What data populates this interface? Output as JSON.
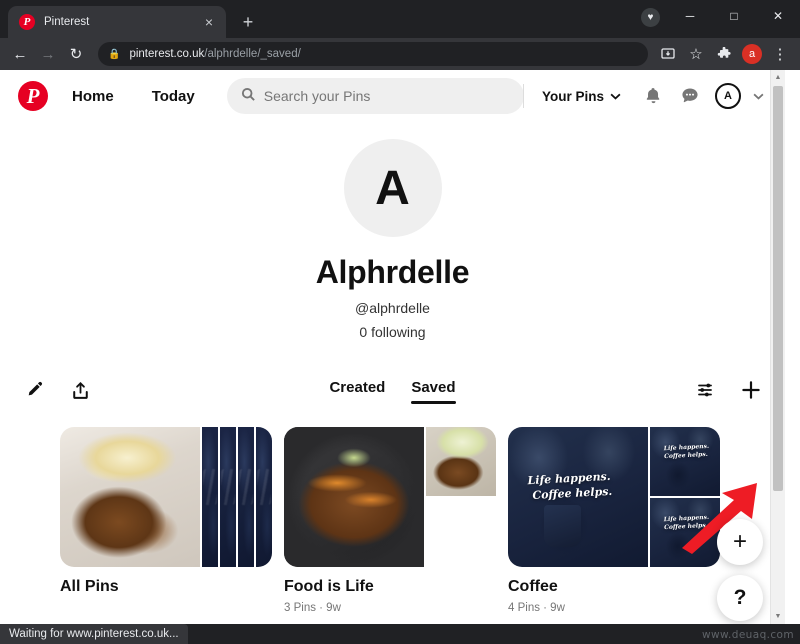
{
  "browser": {
    "tab": {
      "title": "Pinterest",
      "favicon": "pinterest-icon",
      "close": "×"
    },
    "new_tab_label": "+",
    "window_controls": {
      "minimize": "─",
      "maximize": "□",
      "close": "✕"
    },
    "nav": {
      "back": "←",
      "forward": "→",
      "reload": "↻"
    },
    "omnibox": {
      "lock_icon": "lock-icon",
      "domain": "pinterest.co.uk",
      "path": "/alphrdelle/_saved/",
      "install_icon": "install-app-icon",
      "bookmark_icon": "☆",
      "extensions_icon": "puzzle-icon",
      "profile_initial": "a",
      "menu_icon": "⋮"
    },
    "status_text": "Waiting for www.pinterest.co.uk...",
    "watermark": "www.deuaq.com"
  },
  "pinterest": {
    "logo": "pinterest-logo",
    "nav_links": [
      {
        "label": "Home",
        "name": "nav-home"
      },
      {
        "label": "Today",
        "name": "nav-today"
      }
    ],
    "search": {
      "placeholder": "Search your Pins",
      "icon": "search-icon"
    },
    "your_pins": {
      "label": "Your Pins",
      "chevron": "⌄"
    },
    "icons": {
      "notifications": "bell-icon",
      "messages": "chat-bubble-icon",
      "avatar_initial": "A",
      "account_chevron": "⌄"
    },
    "profile": {
      "avatar_initial": "A",
      "display_name": "Alphrdelle",
      "handle": "@alphrdelle",
      "following": "0 following"
    },
    "actions": {
      "edit_icon": "pencil-icon",
      "share_icon": "share-upload-icon",
      "filter_icon": "sliders-filter-icon",
      "add_icon": "plus-icon"
    },
    "tabs": [
      {
        "label": "Created",
        "active": false
      },
      {
        "label": "Saved",
        "active": true
      }
    ],
    "boards": [
      {
        "title": "All Pins",
        "meta": ""
      },
      {
        "title": "Food is Life",
        "meta": "3 Pins · 9w"
      },
      {
        "title": "Coffee",
        "meta": "4 Pins · 9w"
      }
    ],
    "coffee_overlay": {
      "line1": "Life happens.",
      "line2": "Coffee helps."
    },
    "fabs": {
      "create": "+",
      "help": "?"
    },
    "annotation": {
      "type": "red-arrow",
      "color": "#ee1c25",
      "points_to": "plus-icon"
    }
  }
}
